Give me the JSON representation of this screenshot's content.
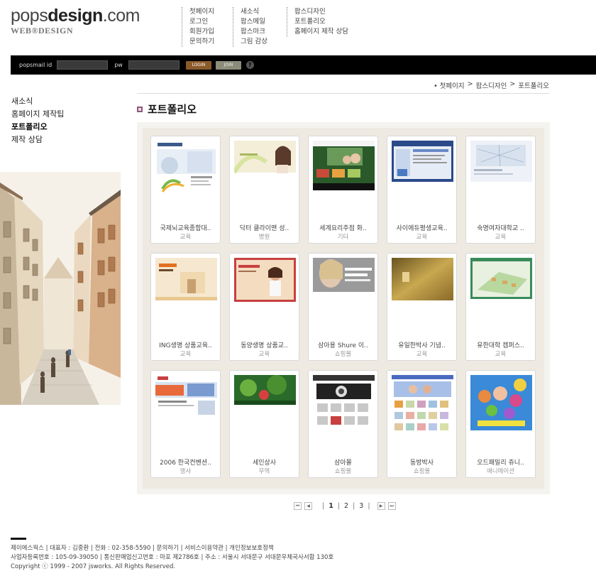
{
  "logo": {
    "pre": "pops",
    "bold": "design",
    "post": ".com",
    "sub": "WEB®DESIGN"
  },
  "top_menu": [
    [
      "첫페이지",
      "로그인",
      "회원가입",
      "문의하기"
    ],
    [
      "새소식",
      "팝스메일",
      "팝스마크",
      "그림 감상"
    ],
    [
      "팝스디자인",
      "포트폴리오",
      "홈페이지 제작 상담"
    ]
  ],
  "login": {
    "id_label": "popsmail id",
    "pw_label": "pw",
    "login_button": "LOGIN",
    "join_button": "JOIN",
    "help": "?"
  },
  "left_nav": [
    {
      "label": "새소식",
      "active": false
    },
    {
      "label": "홈페이지 제작팁",
      "active": false
    },
    {
      "label": "포트폴리오",
      "active": true
    },
    {
      "label": "제작 상담",
      "active": false
    }
  ],
  "breadcrumb": [
    "• 첫페이지",
    ">",
    "팝스디자인",
    ">",
    "포트폴리오"
  ],
  "page_title": "포트폴리오",
  "portfolio": [
    {
      "name": "국제뇌교육종합대..",
      "category": "교육"
    },
    {
      "name": "닥터 클라이맨 성..",
      "category": "병원"
    },
    {
      "name": "세계요리주점 화..",
      "category": "기타"
    },
    {
      "name": "사이에듀평생교육..",
      "category": "교육"
    },
    {
      "name": "숙명여자대학교 ..",
      "category": "교육"
    },
    {
      "name": "ING생명 상품교육..",
      "category": "교육"
    },
    {
      "name": "동양생명 상품교..",
      "category": "교육"
    },
    {
      "name": "삼아용 Shure 이..",
      "category": "쇼핑몰"
    },
    {
      "name": "유일한박사 기념..",
      "category": "교육"
    },
    {
      "name": "유한대학 캠퍼스..",
      "category": "교육"
    },
    {
      "name": "2006 한국컨벤션..",
      "category": "행사"
    },
    {
      "name": "세인상사",
      "category": "무역"
    },
    {
      "name": "삼아몰",
      "category": "쇼핑몰"
    },
    {
      "name": "동방박사",
      "category": "쇼핑몰"
    },
    {
      "name": "오드패밀리 쥬니..",
      "category": "애니메이션"
    }
  ],
  "pagination": {
    "pages": [
      "1",
      "2",
      "3"
    ],
    "current": "1",
    "separator": "|"
  },
  "footer": [
    "제이에스웍스 | 대표자 : 김중환 | 전화 : 02-358-5590 | 문의하기 | 서비스이용약관 | 개인정보보호정책",
    "사업자등록번호 : 105-09-39050 | 통신판매업신고번호 : 마포 제2786호 | 주소 : 서울시 서대문구 서대문우체국사서함 130호",
    "Copyright ⓒ 1999 - 2007 jsworks. All Rights Reserved."
  ],
  "colors": {
    "login_bar": "#000000",
    "login_button": "#8b5a2b",
    "join_button": "#8c8c7a",
    "gallery_bg": "#eeeae2"
  }
}
